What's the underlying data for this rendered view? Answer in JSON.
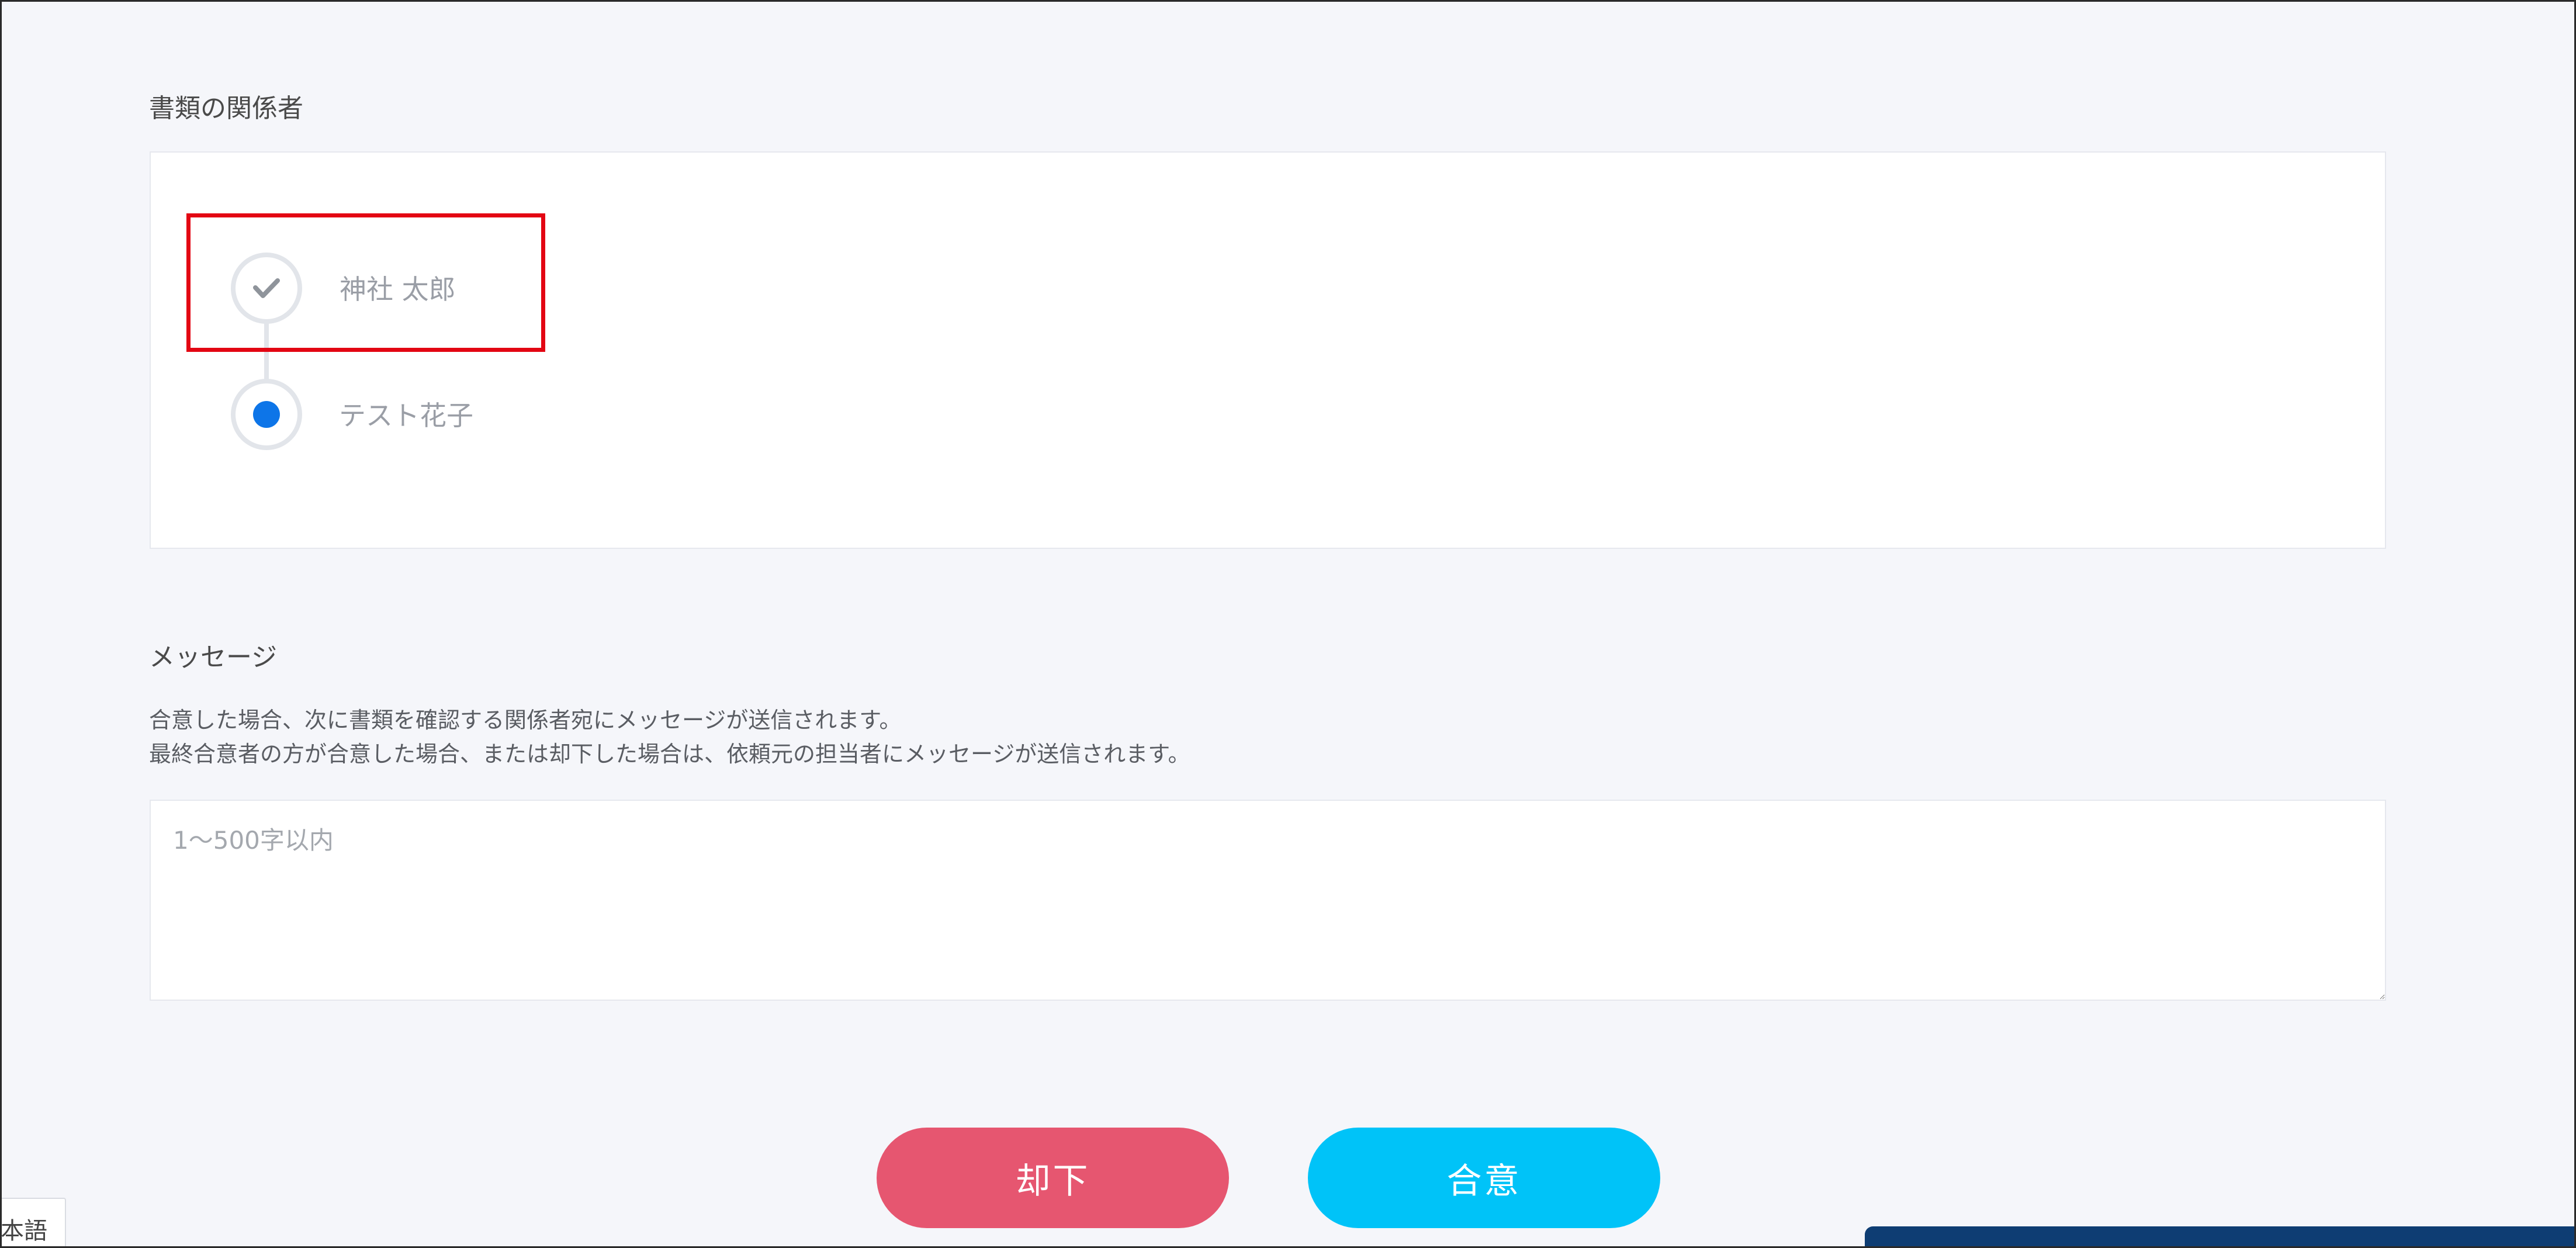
{
  "parties_section": {
    "title": "書類の関係者",
    "parties": [
      {
        "name": "神社 太郎",
        "status": "completed",
        "icon": "check-icon"
      },
      {
        "name": "テスト花子",
        "status": "current",
        "icon": "current-dot-icon"
      }
    ]
  },
  "message_section": {
    "title": "メッセージ",
    "help_line_1": "合意した場合、次に書類を確認する関係者宛にメッセージが送信されます。",
    "help_line_2": "最終合意者の方が合意した場合、または却下した場合は、依頼元の担当者にメッセージが送信されます。",
    "input_placeholder": "1〜500字以内",
    "input_value": ""
  },
  "actions": {
    "reject_label": "却下",
    "agree_label": "合意"
  },
  "language_tab": {
    "label": "本語"
  },
  "colors": {
    "highlight": "#e30613",
    "reject": "#e65670",
    "agree": "#00c3f8",
    "current_step": "#0d75e8",
    "corner_bar": "#0e3d73"
  }
}
